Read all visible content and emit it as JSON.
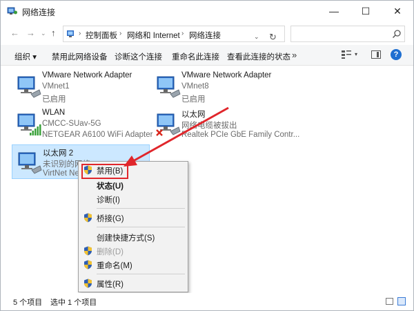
{
  "window": {
    "title": "网络连接"
  },
  "title_buttons": {
    "minimize": "—",
    "maximize": "☐",
    "close": "✕"
  },
  "address": {
    "crumbs": [
      "控制面板",
      "网络和 Internet",
      "网络连接"
    ],
    "separator": "›",
    "drop_glyph": "⌄",
    "refresh_glyph": "↻"
  },
  "nav": {
    "back": "←",
    "forward": "→",
    "dropdown": "⌄",
    "up": "↑"
  },
  "search": {
    "placeholder": "",
    "icon": "search-icon"
  },
  "toolbar": {
    "organize": "组织 ▾",
    "disable_device": "禁用此网络设备",
    "diagnose": "诊断这个连接",
    "rename": "重命名此连接",
    "view_status": "查看此连接的状态",
    "more": "»",
    "view_drop": "▾",
    "help": "?"
  },
  "adapters": [
    {
      "name": "VMware Network Adapter",
      "line2": "VMnet1",
      "line3": "已启用",
      "status": "enabled",
      "selected": false
    },
    {
      "name": "VMware Network Adapter",
      "line2": "VMnet8",
      "line3": "已启用",
      "status": "enabled",
      "selected": false
    },
    {
      "name": "WLAN",
      "line2": "CMCC-SUav-5G",
      "line3": "NETGEAR A6100 WiFi Adapter",
      "status": "wifi",
      "selected": false
    },
    {
      "name": "以太网",
      "line2": "网络电缆被拔出",
      "line3": "Realtek PCIe GbE Family Contr...",
      "status": "disconnected",
      "selected": false
    },
    {
      "name": "以太网 2",
      "line2": "未识别的网络",
      "line3": "VirtNet Ne",
      "status": "enabled",
      "selected": true
    }
  ],
  "context_menu": {
    "items": [
      {
        "label": "禁用(B)",
        "shield": true,
        "bold": false,
        "disabled": false,
        "highlighted": true
      },
      {
        "label": "状态(U)",
        "shield": false,
        "bold": true,
        "disabled": false
      },
      {
        "label": "诊断(I)",
        "shield": false,
        "bold": false,
        "disabled": false
      },
      {
        "label": "桥接(G)",
        "shield": true,
        "bold": false,
        "disabled": false
      },
      {
        "label": "创建快捷方式(S)",
        "shield": false,
        "bold": false,
        "disabled": false
      },
      {
        "label": "删除(D)",
        "shield": true,
        "bold": false,
        "disabled": true
      },
      {
        "label": "重命名(M)",
        "shield": true,
        "bold": false,
        "disabled": false
      },
      {
        "label": "属性(R)",
        "shield": true,
        "bold": false,
        "disabled": false
      }
    ]
  },
  "statusbar": {
    "item_count": "5 个项目",
    "selected_count": "选中 1 个项目"
  },
  "colors": {
    "selection": "#cce8ff",
    "highlight": "#e0262b",
    "accent": "#1f6fd1"
  }
}
